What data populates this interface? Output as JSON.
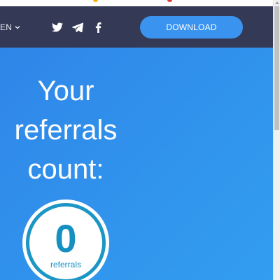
{
  "header": {
    "language": "EN",
    "social_icons": [
      "twitter-icon",
      "telegram-icon",
      "facebook-icon"
    ],
    "download_label": "DOWNLOAD"
  },
  "hero": {
    "title_lines": [
      "Your",
      "referrals",
      "count:"
    ]
  },
  "counter": {
    "value": "0",
    "label": "referrals"
  },
  "colors": {
    "header_bg": "#343a55",
    "hero_gradient_start": "#2f86e8",
    "hero_gradient_end": "#329ef0",
    "button_bg": "#3a93ee",
    "counter_accent": "#1590c0"
  }
}
